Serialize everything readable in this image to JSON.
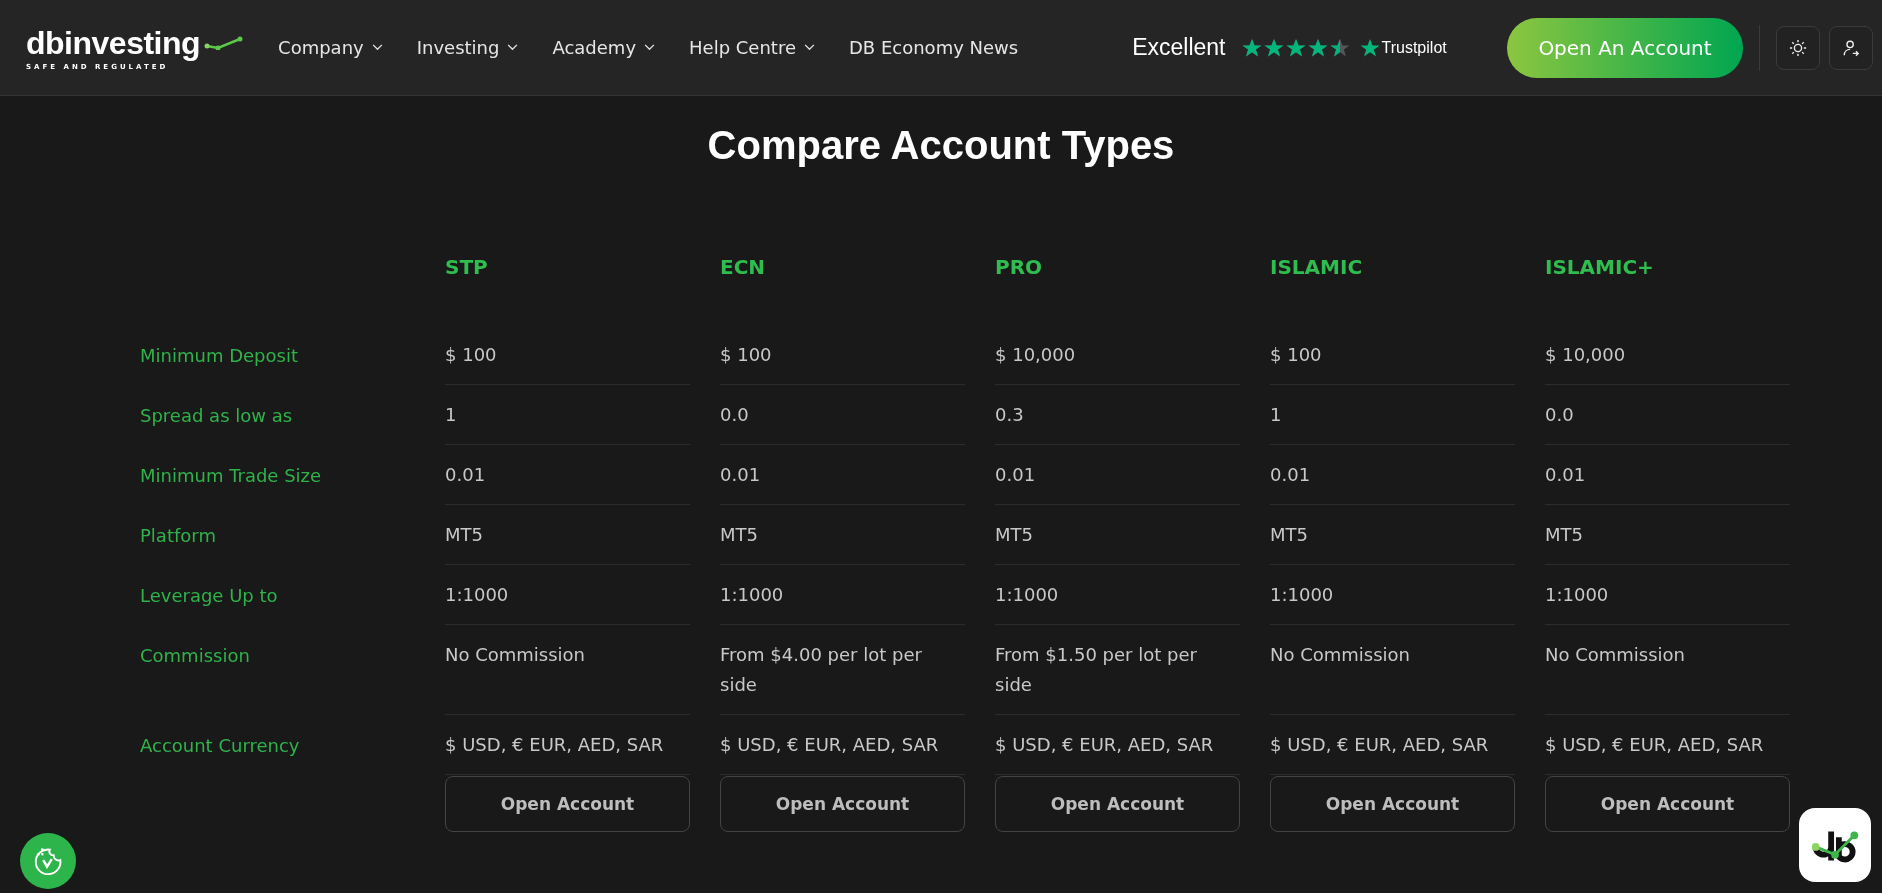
{
  "header": {
    "logo": {
      "name": "dbinvesting",
      "tagline": "SAFE AND REGULATED"
    },
    "nav": [
      {
        "label": "Company",
        "dropdown": true
      },
      {
        "label": "Investing",
        "dropdown": true
      },
      {
        "label": "Academy",
        "dropdown": true
      },
      {
        "label": "Help Centre",
        "dropdown": true
      },
      {
        "label": "DB Economy News",
        "dropdown": false
      }
    ],
    "rating": {
      "label": "Excellent",
      "stars": 4.5,
      "brand": "Trustpilot"
    },
    "cta": "Open An Account"
  },
  "title": "Compare Account Types",
  "accounts": [
    "STP",
    "ECN",
    "PRO",
    "ISLAMIC",
    "ISLAMIC+"
  ],
  "rows": [
    {
      "label": "Minimum Deposit",
      "values": [
        "$ 100",
        "$ 100",
        "$ 10,000",
        "$ 100",
        "$ 10,000"
      ]
    },
    {
      "label": "Spread as low as",
      "values": [
        "1",
        "0.0",
        "0.3",
        "1",
        "0.0"
      ]
    },
    {
      "label": "Minimum Trade Size",
      "values": [
        "0.01",
        "0.01",
        "0.01",
        "0.01",
        "0.01"
      ]
    },
    {
      "label": "Platform",
      "values": [
        "MT5",
        "MT5",
        "MT5",
        "MT5",
        "MT5"
      ]
    },
    {
      "label": "Leverage Up to",
      "values": [
        "1:1000",
        "1:1000",
        "1:1000",
        "1:1000",
        "1:1000"
      ]
    },
    {
      "label": "Commission",
      "values": [
        "No Commission",
        "From $4.00 per lot per side",
        "From $1.50 per lot per side",
        "No Commission",
        "No Commission"
      ]
    },
    {
      "label": "Account Currency",
      "values": [
        "$ USD, € EUR, AED, SAR",
        "$ USD, € EUR, AED, SAR",
        "$ USD, € EUR, AED, SAR",
        "$ USD, € EUR, AED, SAR",
        "$ USD, € EUR, AED, SAR"
      ]
    }
  ],
  "buttons": [
    "Open Account",
    "Open Account",
    "Open Account",
    "Open Account",
    "Open Account"
  ]
}
